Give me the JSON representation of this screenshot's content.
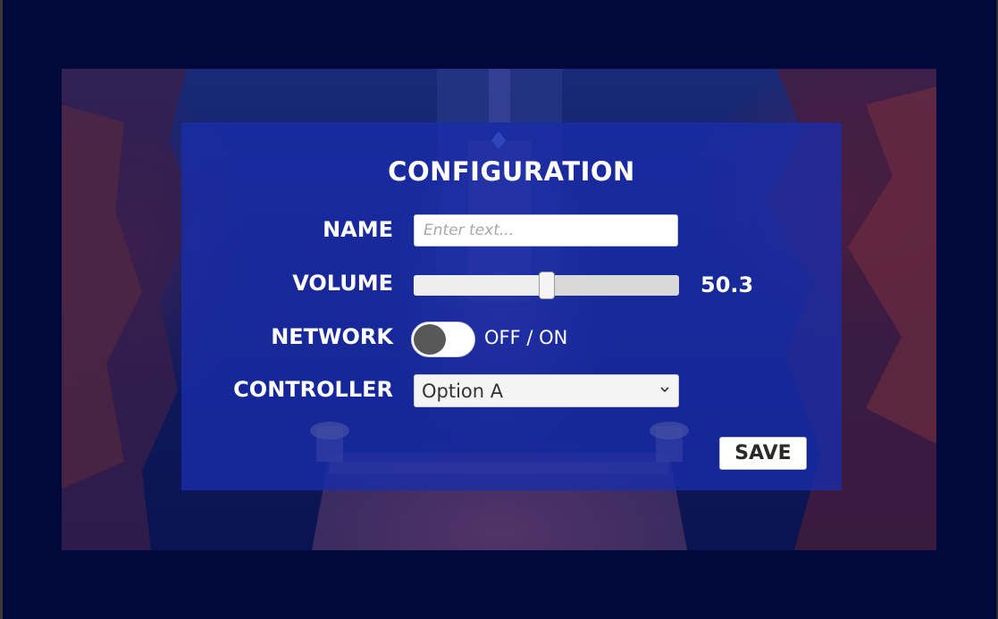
{
  "config": {
    "title": "CONFIGURATION",
    "name": {
      "label": "NAME",
      "placeholder": "Enter text...",
      "value": ""
    },
    "volume": {
      "label": "VOLUME",
      "value": 0.503,
      "display": "50.3"
    },
    "network": {
      "label": "NETWORK",
      "state_text": "OFF / ON",
      "on": false
    },
    "controller": {
      "label": "CONTROLLER",
      "selected": "Option A"
    },
    "save_label": "SAVE"
  },
  "colors": {
    "outer_background": "#00093a",
    "panel": "#1f33b0",
    "text": "#ffffff",
    "toggle_knob": "#585858"
  },
  "icons": {
    "dropdown": "chevron-down-icon"
  }
}
